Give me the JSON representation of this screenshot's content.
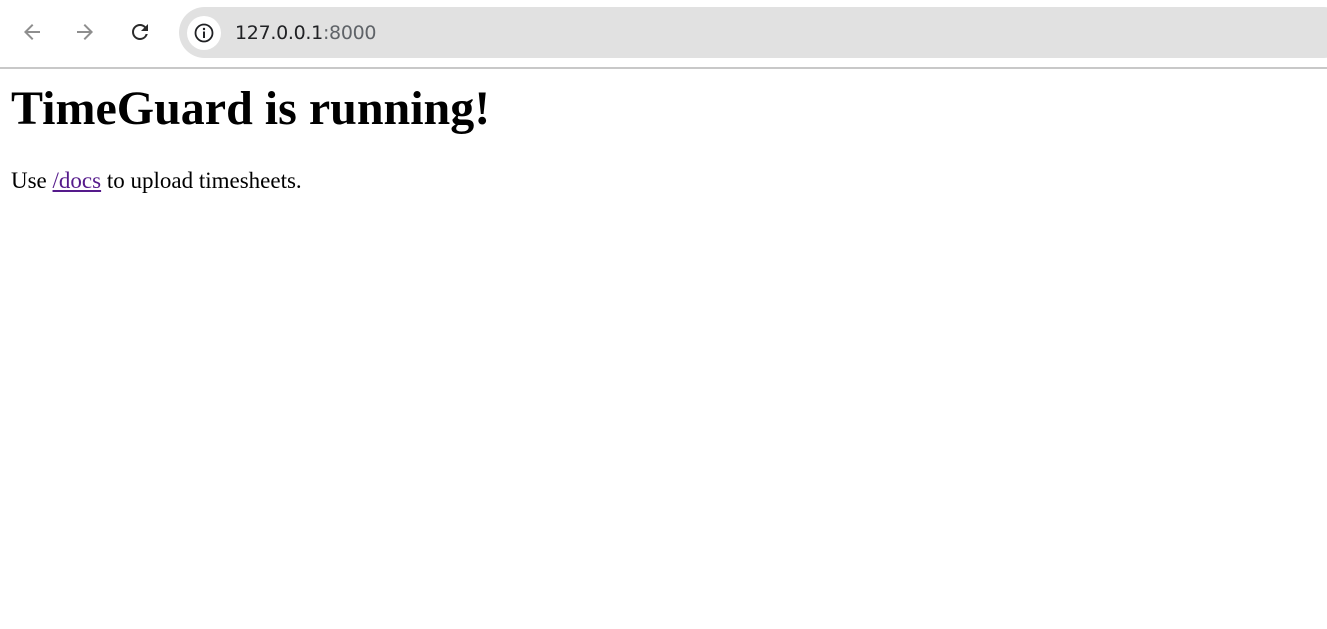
{
  "browser": {
    "url_host": "127.0.0.1",
    "url_port": ":8000",
    "icons": {
      "back": "arrow-left-icon",
      "forward": "arrow-right-icon",
      "reload": "reload-icon",
      "site_info": "info-icon"
    }
  },
  "page": {
    "heading": "TimeGuard is running!",
    "text_before": "Use ",
    "link_text": "/docs",
    "text_after": " to upload timesheets."
  },
  "colors": {
    "link_visited": "#551a8b",
    "omnibox_bg": "#e1e1e1",
    "disabled_icon": "#8e8e8e"
  }
}
